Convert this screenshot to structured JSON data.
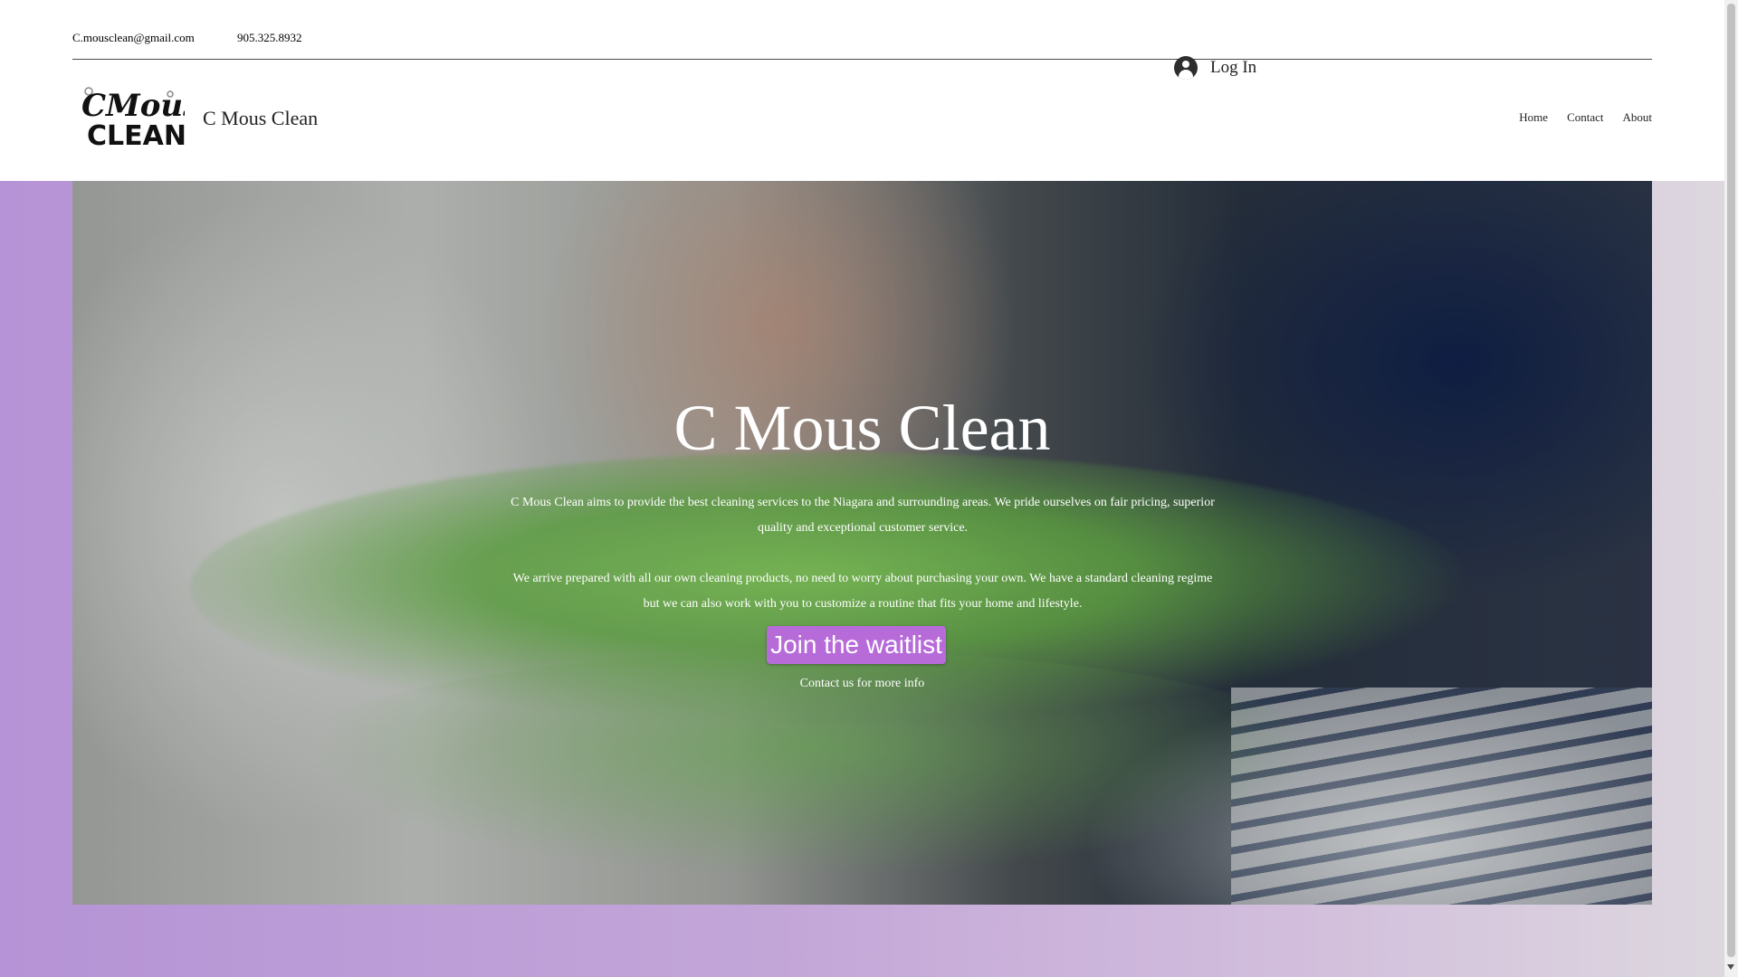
{
  "topbar": {
    "email": "C.mousclean@gmail.com",
    "phone": "905.325.8932"
  },
  "login": {
    "icon": "user-avatar-icon",
    "label": "Log In"
  },
  "header": {
    "logo_line1": "CMous",
    "logo_line2": "CLEAN",
    "site_name": "C Mous Clean"
  },
  "nav": {
    "items": [
      {
        "label": "Home"
      },
      {
        "label": "Contact"
      },
      {
        "label": "About"
      }
    ]
  },
  "hero": {
    "title": "C Mous Clean",
    "paragraph1": "C Mous Clean aims to provide the best cleaning services to the Niagara and surrounding areas. We pride ourselves on fair pricing, superior quality and exceptional customer service.",
    "paragraph2": "We arrive prepared with all our own cleaning products, no need to worry about purchasing your own. We have a standard cleaning regime but we can also work with you to customize a routine that fits your home and lifestyle.",
    "button_label": "Join the waitlist",
    "contact_note": "Contact us for more info"
  },
  "colors": {
    "accent_purple": "#b66bd9",
    "strip_purple": "#b593d6",
    "text_dark": "#222222"
  }
}
